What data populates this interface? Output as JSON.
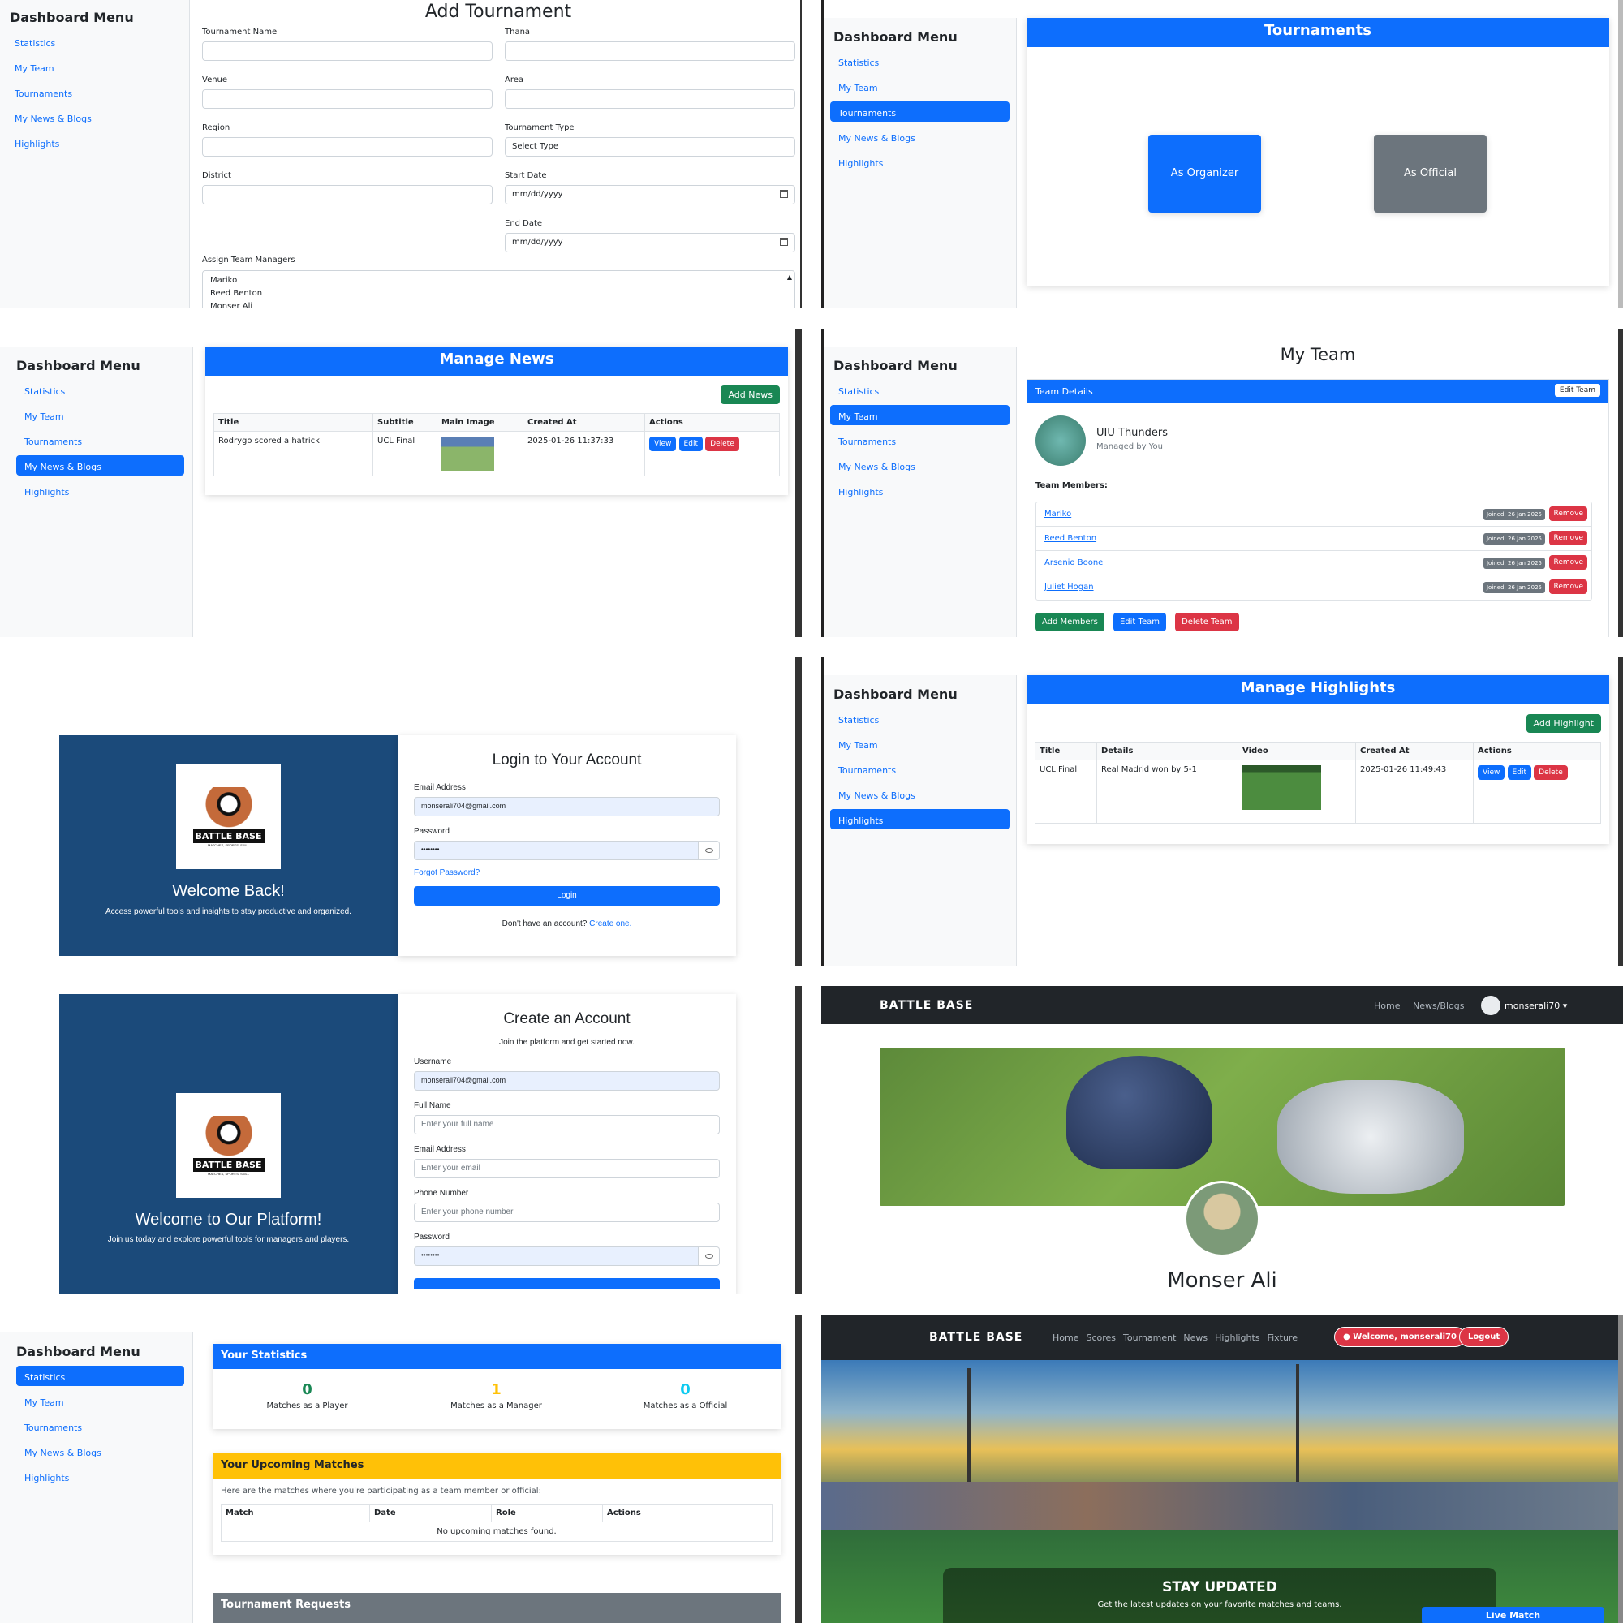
{
  "sidebar": {
    "title": "Dashboard Menu",
    "items": [
      "Statistics",
      "My Team",
      "Tournaments",
      "My News & Blogs",
      "Highlights"
    ]
  },
  "add_tournament": {
    "title": "Add Tournament",
    "fields_left": [
      "Tournament Name",
      "Venue",
      "Region",
      "District"
    ],
    "fields_right": [
      "Thana",
      "Area",
      "Tournament Type",
      "Start Date",
      "End Date"
    ],
    "type_value": "Select Type",
    "date_placeholder": "mm/dd/yyyy",
    "assign_label": "Assign Team Managers",
    "managers": [
      "Mariko",
      "Reed Benton",
      "Monser Ali"
    ]
  },
  "tournaments": {
    "title": "Tournaments",
    "organizer_button": "As Organizer",
    "official_button": "As Official"
  },
  "news": {
    "title": "Manage News",
    "add_button": "Add News",
    "columns": [
      "Title",
      "Subtitle",
      "Main Image",
      "Created At",
      "Actions"
    ],
    "row": {
      "title": "Rodrygo scored a hatrick",
      "subtitle": "UCL Final",
      "created": "2025-01-26 11:37:33"
    },
    "actions": [
      "View",
      "Edit",
      "Delete"
    ]
  },
  "my_team": {
    "title": "My Team",
    "header": "Team Details",
    "edit_button": "Edit Team",
    "team_name": "UIU Thunders",
    "managed_by": "Managed by You",
    "members_label": "Team Members:",
    "members": [
      "Mariko",
      "Reed Benton",
      "Arsenio Boone",
      "Juliet Hogan"
    ],
    "joined": "Joined: 26 Jan 2025",
    "remove": "Remove",
    "add_members": "Add Members",
    "edit_team": "Edit Team",
    "delete_team": "Delete Team"
  },
  "login": {
    "welcome": "Welcome Back!",
    "welcome_sub": "Access powerful tools and insights to stay productive and organized.",
    "title": "Login to Your Account",
    "email_label": "Email Address",
    "email_value": "monserali704@gmail.com",
    "password_label": "Password",
    "password_value": "••••••••",
    "forgot": "Forgot Password?",
    "login_button": "Login",
    "no_account": "Don't have an account?",
    "create": "Create one."
  },
  "highlights": {
    "title": "Manage Highlights",
    "add_button": "Add Highlight",
    "columns": [
      "Title",
      "Details",
      "Video",
      "Created At",
      "Actions"
    ],
    "row": {
      "title": "UCL Final",
      "details": "Real Madrid won by 5-1",
      "created": "2025-01-26 11:49:43"
    },
    "actions": [
      "View",
      "Edit",
      "Delete"
    ]
  },
  "register": {
    "welcome": "Welcome to Our Platform!",
    "welcome_sub": "Join us today and explore powerful tools for managers and players.",
    "title": "Create an Account",
    "subtitle": "Join the platform and get started now.",
    "username_label": "Username",
    "username_value": "monserali704@gmail.com",
    "fullname_label": "Full Name",
    "fullname_ph": "Enter your full name",
    "email_label": "Email Address",
    "email_ph": "Enter your email",
    "phone_label": "Phone Number",
    "phone_ph": "Enter your phone number",
    "password_label": "Password",
    "password_value": "••••••••"
  },
  "profile": {
    "brand": "BATTLE BASE",
    "nav": [
      "Home",
      "News/Blogs"
    ],
    "user": "monserali70 ▾",
    "name": "Monser Ali"
  },
  "stats": {
    "title": "Your Statistics",
    "items": [
      {
        "value": "0",
        "label": "Matches as a Player",
        "color": "#198754"
      },
      {
        "value": "1",
        "label": "Matches as a Manager",
        "color": "#ffc107"
      },
      {
        "value": "0",
        "label": "Matches as a Official",
        "color": "#0dcaf0"
      }
    ],
    "upcoming_title": "Your Upcoming Matches",
    "upcoming_desc": "Here are the matches where you're participating as a team member or official:",
    "columns": [
      "Match",
      "Date",
      "Role",
      "Actions"
    ],
    "empty": "No upcoming matches found.",
    "requests_title": "Tournament Requests"
  },
  "home": {
    "brand": "BATTLE BASE",
    "nav": [
      "Home",
      "Scores",
      "Tournament",
      "News",
      "Highlights",
      "Fixture"
    ],
    "welcome_button": "Welcome, monserali70",
    "logout": "Logout",
    "hero_title": "STAY UPDATED",
    "hero_sub": "Get the latest updates on your favorite matches and teams.",
    "live_button": "Live Match"
  },
  "logo": {
    "line1": "BATTLE BASE",
    "line2": "MATCHES, SPORTS, SKILL"
  },
  "colors": {
    "primary": "#0d6efd",
    "danger": "#dc3545",
    "success": "#198754",
    "secondary": "#6c757d",
    "navy": "#1b4a7a"
  }
}
